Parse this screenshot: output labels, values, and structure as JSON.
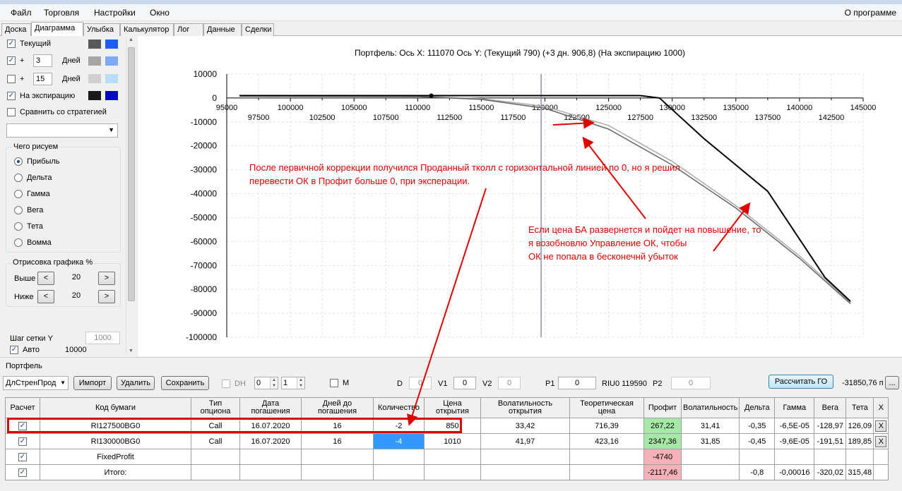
{
  "menu": {
    "file": "Файл",
    "trade": "Торговля",
    "settings": "Настройки",
    "window": "Окно",
    "about": "О программе"
  },
  "tabs": [
    "Доска",
    "Диаграмма",
    "Улыбка",
    "Калькулятор",
    "Лог",
    "Данные",
    "Сделки"
  ],
  "left": {
    "current": "Текущий",
    "plus": "+",
    "days": "Дней",
    "plus1_value": "3",
    "plus2_value": "15",
    "expiration": "На экспирацию",
    "compare": "Сравнить со стратегией",
    "what_title": "Чего рисуем",
    "radios": [
      "Прибыль",
      "Дельта",
      "Гамма",
      "Вега",
      "Тета",
      "Вомма"
    ],
    "render_title": "Отрисовка графика %",
    "above": "Выше",
    "below": "Ниже",
    "above_value": "20",
    "below_value": "20",
    "btn_left": "<",
    "btn_right": ">",
    "grid_step": "Шаг сетки Y",
    "grid_step_value": "1000",
    "auto": "Авто",
    "auto_value": "10000",
    "swatches": {
      "current": [
        "#595959",
        "#1f5cf5"
      ],
      "plus1": [
        "#a6a6a6",
        "#7fa9f7"
      ],
      "plus2": [
        "#d0d0d0",
        "#b9dcf7"
      ],
      "exp": [
        "#1a1a1a",
        "#0000cc"
      ]
    }
  },
  "chart": {
    "header": "Портфель:  Ось X:  111070  Ось Y:   (Текущий 790)  (+3 дн. 906,8)  (На экспирацию 1000)",
    "cursor_x": 111070,
    "vline_x": 119700
  },
  "chart_data": {
    "type": "line",
    "xlim": [
      95000,
      145000
    ],
    "ylim": [
      -100000,
      10000
    ],
    "x_ticks_top": [
      "95000",
      "100000",
      "105000",
      "110000",
      "115000",
      "120000",
      "125000",
      "130000",
      "135000",
      "140000",
      "145000"
    ],
    "x_ticks_bottom": [
      "97500",
      "102500",
      "107500",
      "112500",
      "117500",
      "122500",
      "127500",
      "132500",
      "137500",
      "142500"
    ],
    "y_ticks": [
      "10000",
      "0",
      "-10000",
      "-20000",
      "-30000",
      "-40000",
      "-50000",
      "-60000",
      "-70000",
      "-80000",
      "-90000",
      "-100000"
    ],
    "series": [
      {
        "color": "#000000",
        "x": [
          96000,
          110000,
          125000,
          127500,
          129000,
          132500,
          137500,
          142000,
          144000
        ],
        "y": [
          1000,
          1000,
          1000,
          1000,
          0,
          -17000,
          -39000,
          -75000,
          -85000
        ]
      },
      {
        "color": "#666666",
        "x": [
          96000,
          110000,
          115000,
          120000,
          125000,
          130000,
          135000,
          140000,
          144000
        ],
        "y": [
          800,
          600,
          -600,
          -4300,
          -13000,
          -28000,
          -46000,
          -67000,
          -86000
        ]
      },
      {
        "color": "#aaaaaa",
        "x": [
          96000,
          110000,
          115000,
          120000,
          125000,
          130000,
          135000,
          140000,
          144000
        ],
        "y": [
          900,
          700,
          -300,
          -3500,
          -11500,
          -26500,
          -45000,
          -66000,
          -85500
        ]
      }
    ]
  },
  "annotations": {
    "a1_line1": "После первичной коррекции получился Проданный тколл с горизонтальной линией по 0, но я решил",
    "a1_line2": "перевести ОК в Профит больше 0, при эксперации.",
    "a2_line1": "Если цена БА развернется и пойдет на повышение, то",
    "a2_line2": "я возобновлю Управление ОК, чтобы",
    "a2_line3": "ОК не попала в бесконечнй убыток"
  },
  "portfolio": {
    "title": "Портфель",
    "combo": "ДлСтренПрод",
    "import": "Импорт",
    "delete": "Удалить",
    "save": "Сохранить",
    "dh": "DH",
    "dh_v1": "0",
    "dh_v2": "1",
    "m": "M",
    "d": "D",
    "d_val": "0",
    "v1": "V1",
    "v1_val": "0",
    "v2": "V2",
    "v2_val": "0",
    "p1": "P1",
    "p1_val": "0",
    "riu": "RIU0 119590",
    "p2": "P2",
    "p2_val": "0",
    "calc": "Рассчитать ГО",
    "go_value": "-31850,76 п",
    "ellipsis": "..."
  },
  "table": {
    "headers": [
      "Расчет",
      "Код бумаги",
      "Тип опциона",
      "Дата погашения",
      "Дней до погашения",
      "Количество",
      "Цена открытия",
      "Волатильность открытия",
      "Теоретическая цена",
      "Профит",
      "Волатильность",
      "Дельта",
      "Гамма",
      "Вега",
      "Тета",
      "X"
    ],
    "rows": [
      {
        "code": "RI127500BG0",
        "type": "Call",
        "date": "16.07.2020",
        "days": "16",
        "qty": "-2",
        "price": "850",
        "vol_open": "33,42",
        "theo": "716,39",
        "profit": "267,22",
        "vol": "31,41",
        "delta": "-0,35",
        "gamma": "-6,5E-05",
        "vega": "-128,97",
        "theta": "126,09",
        "x": "X"
      },
      {
        "code": "RI130000BG0",
        "type": "Call",
        "date": "16.07.2020",
        "days": "16",
        "qty": "-4",
        "price": "1010",
        "vol_open": "41,97",
        "theo": "423,16",
        "profit": "2347,36",
        "vol": "31,85",
        "delta": "-0,45",
        "gamma": "-9,6E-05",
        "vega": "-191,51",
        "theta": "189,85",
        "x": "X"
      },
      {
        "code": "FixedProfit",
        "profit": "-4740"
      },
      {
        "code": "Итого:",
        "profit": "-2117,46",
        "delta": "-0,8",
        "gamma": "-0,00016",
        "vega": "-320,02",
        "theta": "315,48"
      }
    ]
  }
}
